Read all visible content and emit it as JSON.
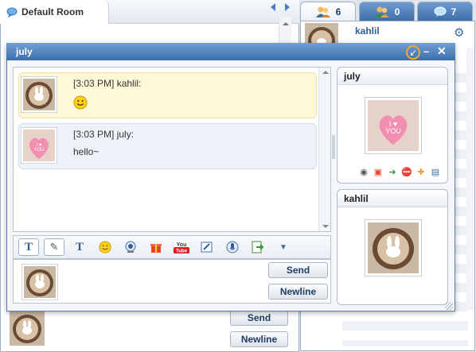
{
  "room": {
    "tab_label": "Default Room",
    "send_label": "Send",
    "newline_label": "Newline"
  },
  "panel": {
    "tabs": [
      {
        "name": "users",
        "count": "6"
      },
      {
        "name": "friends",
        "count": "0"
      },
      {
        "name": "chats",
        "count": "7"
      }
    ],
    "user_name": "kahlil"
  },
  "chat_window": {
    "title": "july",
    "messages": [
      {
        "time": "[3:03 PM]",
        "sender": "kahlil:",
        "text": "",
        "emoticon": "smiley-emoticon",
        "avatar": "coffee-latte"
      },
      {
        "time": "[3:03 PM]",
        "sender": "july:",
        "text": "hello~",
        "avatar": "candy-heart"
      }
    ],
    "toolbar": [
      "font-style-icon",
      "brush-icon",
      "text-color-icon",
      "emoticon-icon",
      "webcam-icon",
      "gift-icon",
      "youtube-icon",
      "whiteboard-icon",
      "voice-icon",
      "send-file-icon",
      "more-arrow-icon"
    ],
    "send_label": "Send",
    "newline_label": "Newline",
    "profiles": [
      {
        "name": "july",
        "photo": "candy-heart"
      },
      {
        "name": "kahlil",
        "photo": "coffee-latte"
      }
    ],
    "profile_actions": [
      "webcam-icon",
      "gift-icon",
      "send-file-icon",
      "block-icon",
      "add-friend-icon",
      "profile-card-icon"
    ]
  },
  "colors": {
    "title_bar": "#4f81bd",
    "accent": "#3f6fa9",
    "highlight_message": "#fff8d6",
    "plain_message": "#eef3f9"
  }
}
